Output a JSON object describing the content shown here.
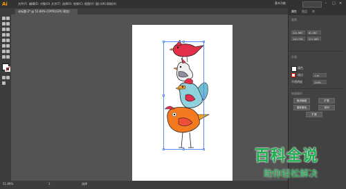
{
  "app": {
    "logo": "Ai"
  },
  "menu": {
    "items": [
      "文件(F)",
      "编辑(E)",
      "对象(O)",
      "文字(T)",
      "选择(S)",
      "效果(C)",
      "视图(V)",
      "窗口(W)",
      "帮助(H)"
    ]
  },
  "header_right": {
    "workspace": "基本功能",
    "search_placeholder": "",
    "minimize": "–",
    "maximize": "□",
    "close": "✕"
  },
  "document_tab": {
    "title": "未标题-2* @ 51.89% (CMYK/GPU 预览)"
  },
  "status": {
    "zoom": "51.89%",
    "artboard": "1",
    "tool": "选择"
  },
  "right_panel": {
    "tabs": [
      "属性",
      "图层",
      "库"
    ],
    "section_transform": "变换",
    "x_value": "121.987",
    "y_value": "140.728",
    "w_value": "61.567",
    "h_value": "211.565",
    "section_appearance": "外观",
    "fill_label": "填色",
    "stroke_label": "描边",
    "stroke_weight": "1 pt",
    "opacity_label": "不透明度",
    "opacity_value": "100%",
    "quick_actions": "快速操作",
    "btn_release": "取消编组",
    "btn_expand": "扩展",
    "btn_arrange": "重新着色",
    "btn_align": "排列"
  },
  "watermark": {
    "title": "百科全说",
    "subtitle": "助你轻松解决"
  },
  "colors": {
    "accent": "#4e8cff",
    "brand": "#19b04b",
    "ui_dark": "#323232",
    "ui_mid": "#535353"
  }
}
